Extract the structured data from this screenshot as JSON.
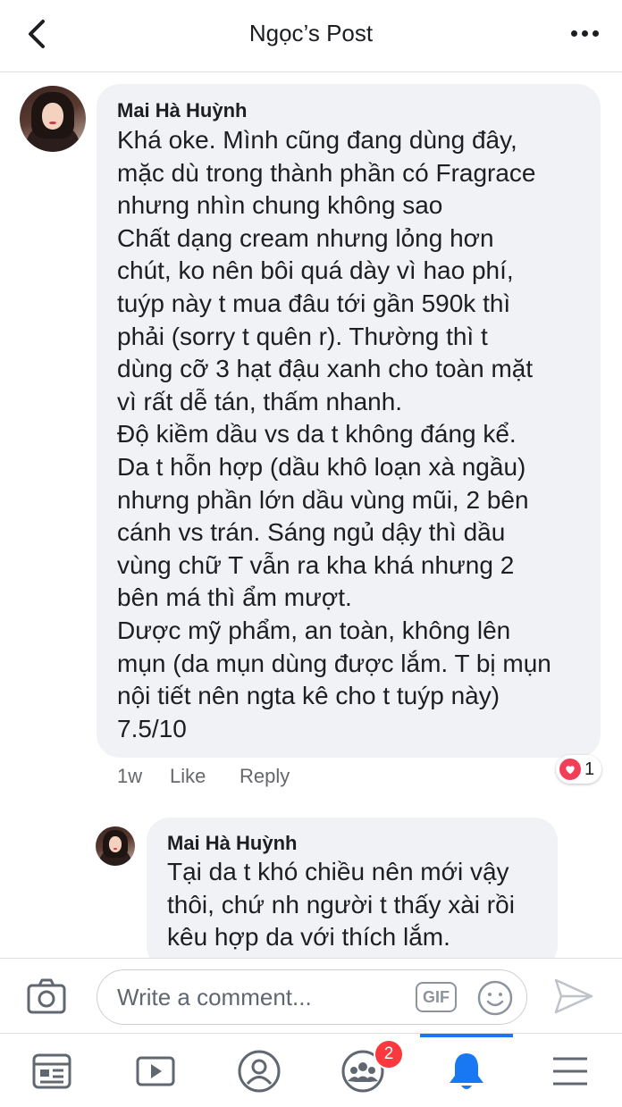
{
  "header": {
    "title": "Ngọc’s Post"
  },
  "comments": [
    {
      "author": "Mai Hà Huỳnh",
      "text": "Khá oke. Mình cũng đang dùng đây,\nmặc dù trong thành phần có Fragrace\nnhưng nhìn chung không sao\nChất dạng cream nhưng lỏng hơn\nchút, ko nên bôi quá dày vì hao phí,\ntuýp này t mua đâu tới gần 590k thì\nphải (sorry t quên r). Thường thì t\ndùng cỡ 3 hạt đậu xanh cho toàn mặt\nvì rất dễ tán, thấm nhanh.\nĐộ kiềm dầu vs da t không đáng kể.\nDa t hỗn hợp (dầu khô loạn xà ngầu)\nnhưng phần lớn dầu vùng mũi, 2 bên\ncánh vs trán. Sáng ngủ dậy thì dầu\nvùng chữ T vẫn ra kha khá nhưng 2\nbên má thì ẩm mượt.\nDược mỹ phẩm, an toàn, không lên\nmụn (da mụn dùng được lắm. T bị mụn\nnội tiết nên ngta kê cho t tuýp này)\n7.5/10",
      "time": "1w",
      "like_label": "Like",
      "reply_label": "Reply",
      "reaction_count": "1"
    },
    {
      "author": "Mai Hà Huỳnh",
      "text": "Tại da t khó chiều nên mới vậy\nthôi, chứ nh người t thấy xài rồi\nkêu hợp da với thích lắm."
    }
  ],
  "composer": {
    "placeholder": "Write a comment...",
    "gif_label": "GIF"
  },
  "tabbar": {
    "groups_badge": "2",
    "active_tab": "notifications"
  },
  "colors": {
    "accent": "#1877f2",
    "badge": "#fa383e",
    "bubble": "#f0f2f5",
    "heart": "#f33e58"
  }
}
